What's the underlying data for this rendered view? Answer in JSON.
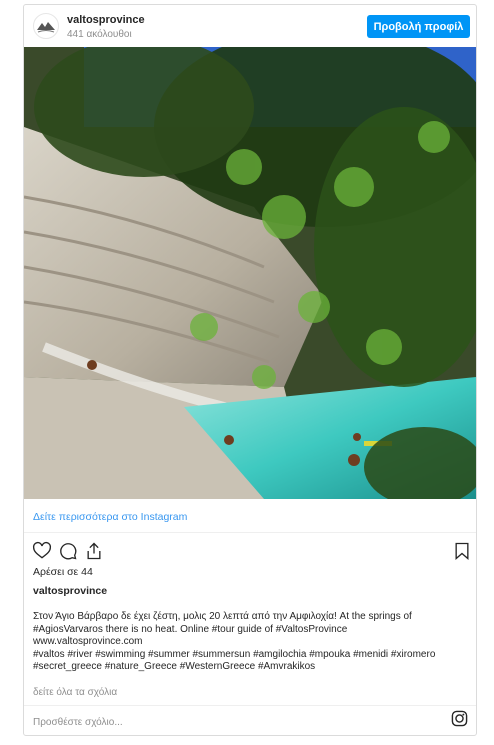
{
  "header": {
    "username": "valtosprovince",
    "followers": "441 ακόλουθοι",
    "profile_button": "Προβολή προφίλ",
    "avatar_icon": "valtos-logo-icon"
  },
  "photo": {
    "description_icon": "river-photo"
  },
  "more_link": "Δείτε περισσότερα στο Instagram",
  "actions": {
    "like_icon": "heart-icon",
    "comment_icon": "comment-icon",
    "share_icon": "share-icon",
    "save_icon": "bookmark-icon"
  },
  "likes": "Αρέσει σε 44",
  "author": "valtosprovince",
  "caption_lines": [
    "Στον Άγιο Βάρβαρο δε έχει ζέστη, μολις 20 λεπτά από την Αμφιλοχία! At the springs of",
    "#AgiosVarvaros there is no heat. Online #tour guide of #ValtosProvince",
    "www.valtosprovince.com",
    "#valtos #river #swimming #summer #summersun #amgilochia #mpouka #menidi #xiromero",
    "#secret_greece #nature_Greece #WesternGreece #Amvrakikos"
  ],
  "all_comments": "δείτε όλα τα σχόλια",
  "comment_placeholder": "Προσθέστε σχόλιο...",
  "colors": {
    "accent": "#0095f6",
    "link": "#3897f0",
    "water": "#3ec9c0"
  }
}
